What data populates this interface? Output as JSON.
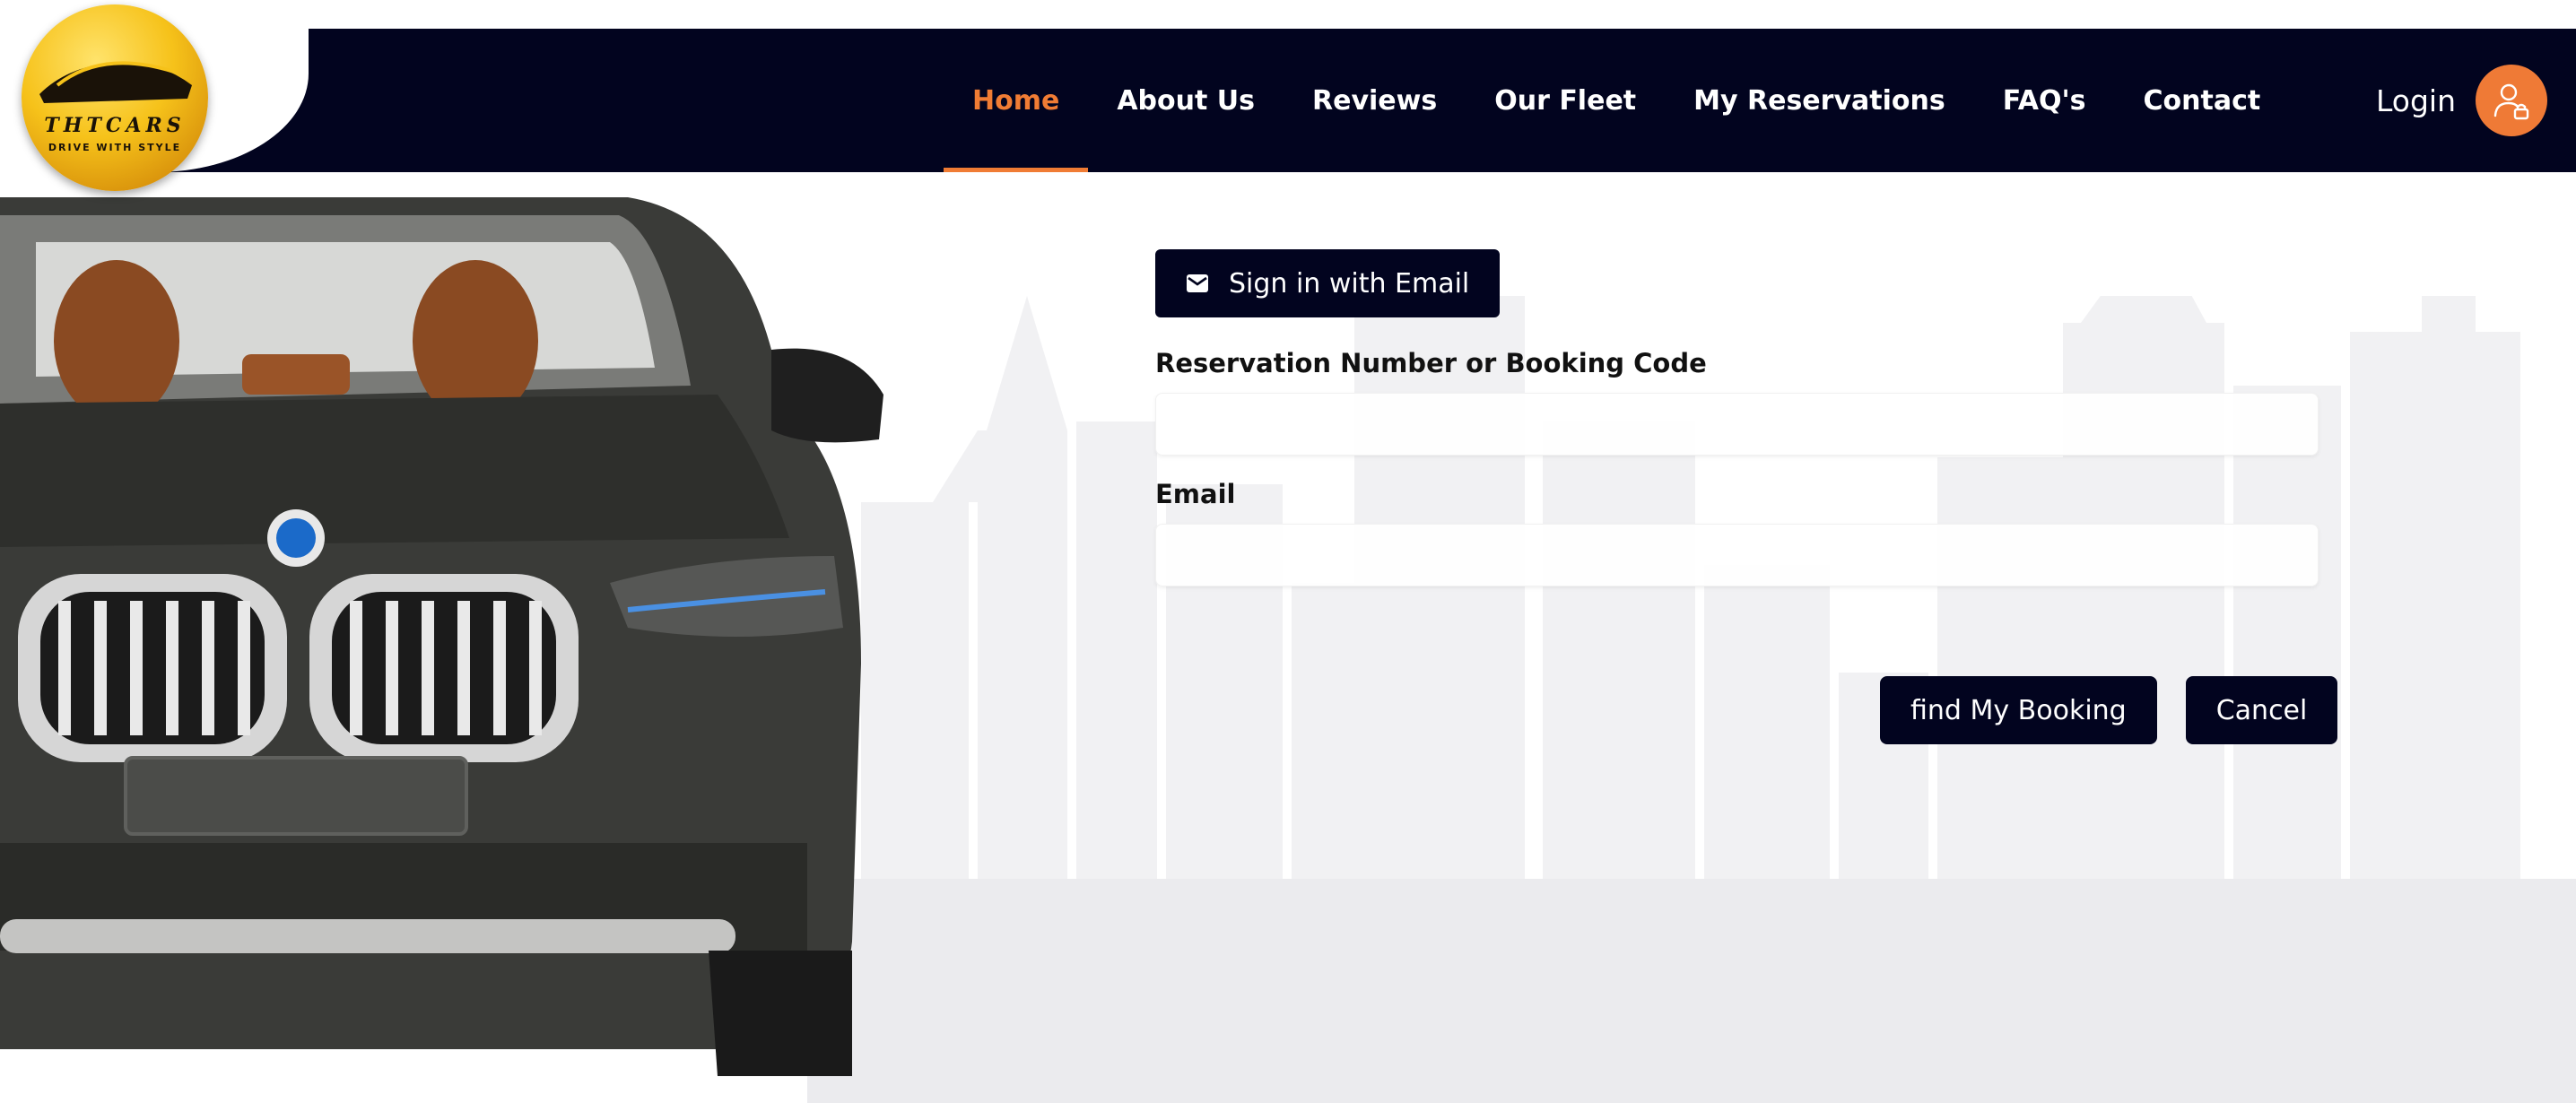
{
  "brand": {
    "logo_text": "THTCARS",
    "tagline": "DRIVE WITH STYLE"
  },
  "nav": {
    "items": [
      {
        "label": "Home",
        "active": true
      },
      {
        "label": "About Us"
      },
      {
        "label": "Reviews"
      },
      {
        "label": "Our Fleet"
      },
      {
        "label": "My Reservations"
      },
      {
        "label": "FAQ's"
      },
      {
        "label": "Contact"
      }
    ],
    "login_label": "Login"
  },
  "form": {
    "signin_email_label": "Sign in with Email",
    "reservation_label": "Reservation Number or Booking Code",
    "reservation_value": "",
    "email_label": "Email",
    "email_value": "",
    "find_booking_label": "find My Booking",
    "cancel_label": "Cancel"
  },
  "colors": {
    "navy": "#02041f",
    "accent": "#f07c34",
    "avatar": "#ef7a36"
  },
  "icons": {
    "signin": "mail-icon",
    "login": "user-lock-icon"
  }
}
